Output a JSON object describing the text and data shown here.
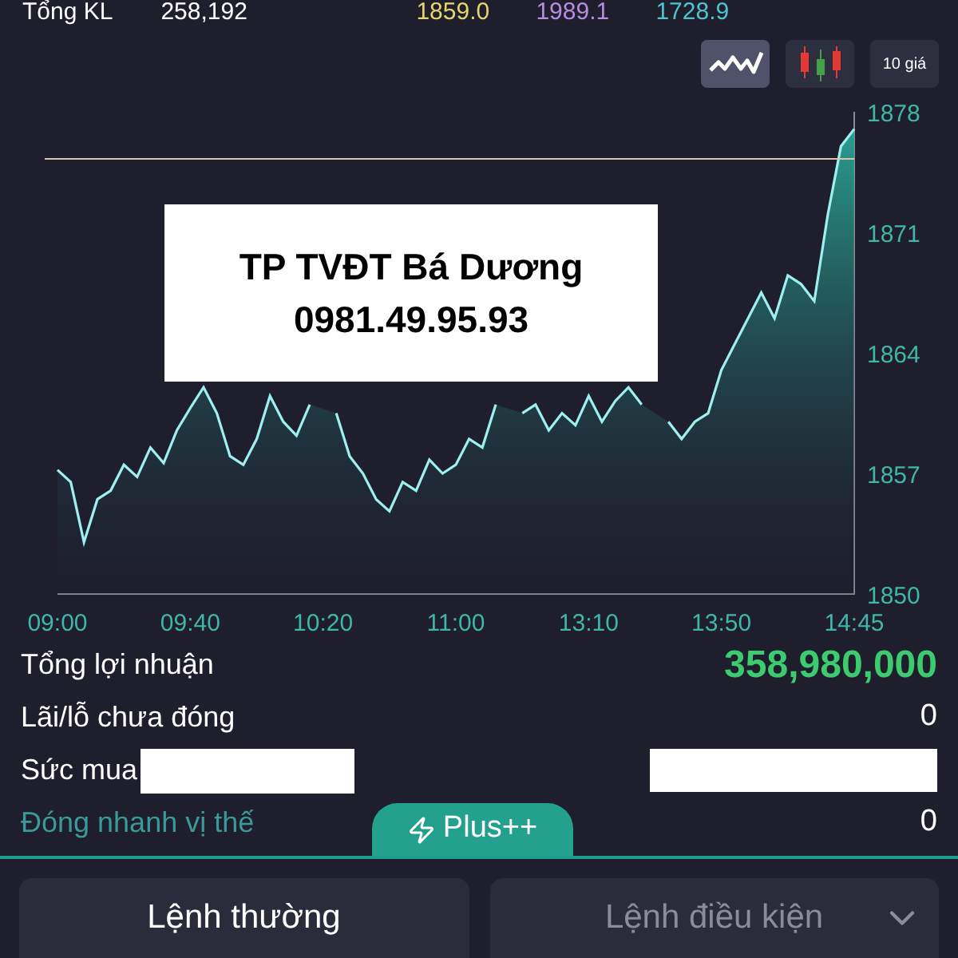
{
  "summary_row": {
    "label": "Tổng KL",
    "volume": "258,192",
    "prices": [
      {
        "text": "1859.0",
        "color": "#e6d56a"
      },
      {
        "text": "1989.1",
        "color": "#b88ce0"
      },
      {
        "text": "1728.9",
        "color": "#4fc3d0"
      }
    ]
  },
  "chart_toolbar": [
    {
      "kind": "line",
      "selected": true
    },
    {
      "kind": "candles",
      "selected": false
    },
    {
      "kind": "text",
      "label": "10 giá",
      "selected": false
    }
  ],
  "overlay": {
    "lines": [
      "TP TVĐT Bá Dương",
      "0981.49.95.93"
    ]
  },
  "chart": {
    "chart_data": {
      "type": "area",
      "categories": [
        "09:00",
        null,
        null,
        null,
        null,
        null,
        null,
        null,
        null,
        null,
        "09:40",
        null,
        null,
        null,
        null,
        null,
        null,
        null,
        null,
        null,
        "10:20",
        null,
        null,
        null,
        null,
        null,
        null,
        null,
        null,
        null,
        "11:00",
        null,
        null,
        null,
        null,
        null,
        null,
        null,
        null,
        null,
        "13:10",
        null,
        null,
        null,
        null,
        null,
        null,
        null,
        null,
        null,
        "13:50",
        null,
        null,
        null,
        null,
        null,
        null,
        null,
        null,
        null,
        "14:45"
      ],
      "yticks": [
        1850,
        1857,
        1864,
        1871,
        1878
      ],
      "ylim": [
        1850,
        1878
      ],
      "values": [
        1857.2,
        1856.5,
        1853.0,
        1855.5,
        1856.0,
        1857.5,
        1856.8,
        1858.5,
        1857.6,
        1859.5,
        1860.8,
        1862.0,
        1860.5,
        1858.0,
        1857.5,
        1859.0,
        1861.5,
        1860.0,
        1859.2,
        1861.0,
        null,
        1860.5,
        1858.0,
        1857.0,
        1855.5,
        1854.8,
        1856.5,
        1856.0,
        1857.8,
        1857.0,
        1857.5,
        1859.0,
        1858.5,
        1861.0,
        null,
        1860.5,
        1861.0,
        1859.5,
        1860.5,
        1859.8,
        1861.5,
        1860.0,
        1861.2,
        1862.0,
        1861.0,
        null,
        1860.0,
        1859.0,
        1860.0,
        1860.5,
        1863.0,
        1864.5,
        1866.0,
        1867.5,
        1866.0,
        1868.5,
        1868.0,
        1867.0,
        1872.0,
        1876.0,
        1877.0
      ]
    }
  },
  "summary": [
    {
      "label": "Tổng lợi nhuận",
      "kind": "profit",
      "value": "358,980,000"
    },
    {
      "label": "Lãi/lỗ chưa đóng",
      "kind": "plain",
      "value": "0"
    },
    {
      "label": "Sức mua",
      "kind": "redacted"
    },
    {
      "label": "Đóng nhanh vị thế",
      "kind": "link",
      "value": "0"
    }
  ],
  "plus_tab": {
    "label": "Plus++"
  },
  "order_tabs": [
    {
      "label": "Lệnh thường",
      "selected": true,
      "dropdown": false
    },
    {
      "label": "Lệnh điều kiện",
      "selected": false,
      "dropdown": true
    }
  ]
}
